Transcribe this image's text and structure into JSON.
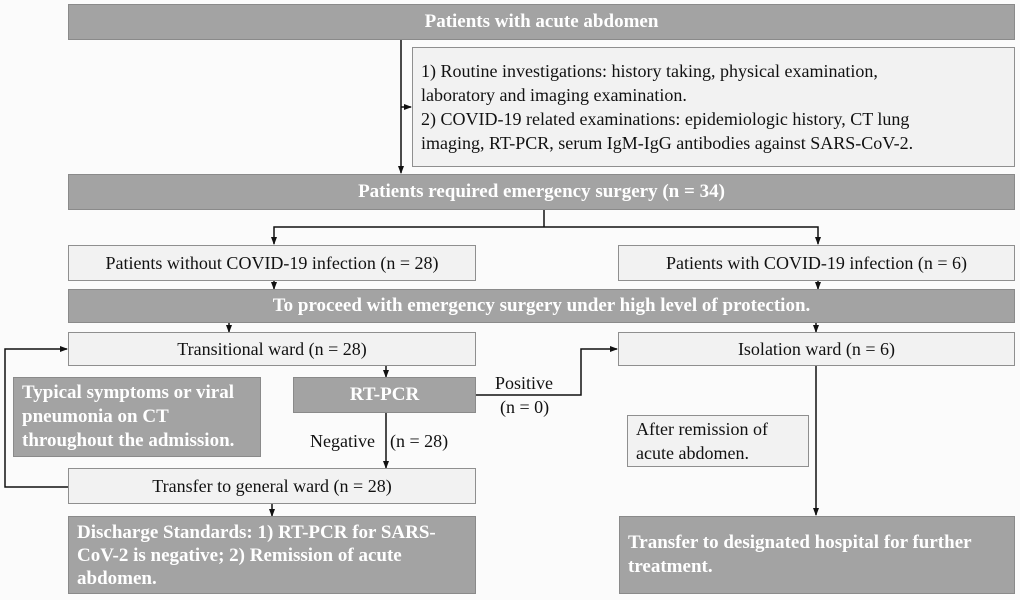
{
  "flowchart": {
    "top": "Patients with acute abdomen",
    "exams": {
      "line1": "1) Routine investigations: history taking, physical examination,",
      "line2": "laboratory and imaging examination.",
      "line3": "2) COVID-19 related examinations: epidemiologic history, CT lung",
      "line4": "imaging, RT-PCR, serum IgM-IgG antibodies against SARS-CoV-2."
    },
    "surgery": "Patients required emergency surgery (n = 34)",
    "without_covid": "Patients without COVID-19 infection (n = 28)",
    "with_covid": "Patients with COVID-19 infection (n = 6)",
    "protection": "To proceed with emergency surgery under high level of protection.",
    "transitional": "Transitional ward (n = 28)",
    "isolation": "Isolation ward (n = 6)",
    "symptoms": "Typical symptoms or viral pneumonia on CT throughout the admission.",
    "rtpcr": "RT-PCR",
    "positive": "Positive",
    "positive_n": "(n = 0)",
    "negative": "Negative",
    "negative_n": "(n = 28)",
    "general_ward": "Transfer to general ward (n = 28)",
    "after_remission": "After remission of acute abdomen.",
    "discharge": "Discharge Standards: 1) RT-PCR for  SARS-CoV-2 is negative; 2) Remission of acute abdomen.",
    "designated": "Transfer to designated hospital for further treatment."
  }
}
